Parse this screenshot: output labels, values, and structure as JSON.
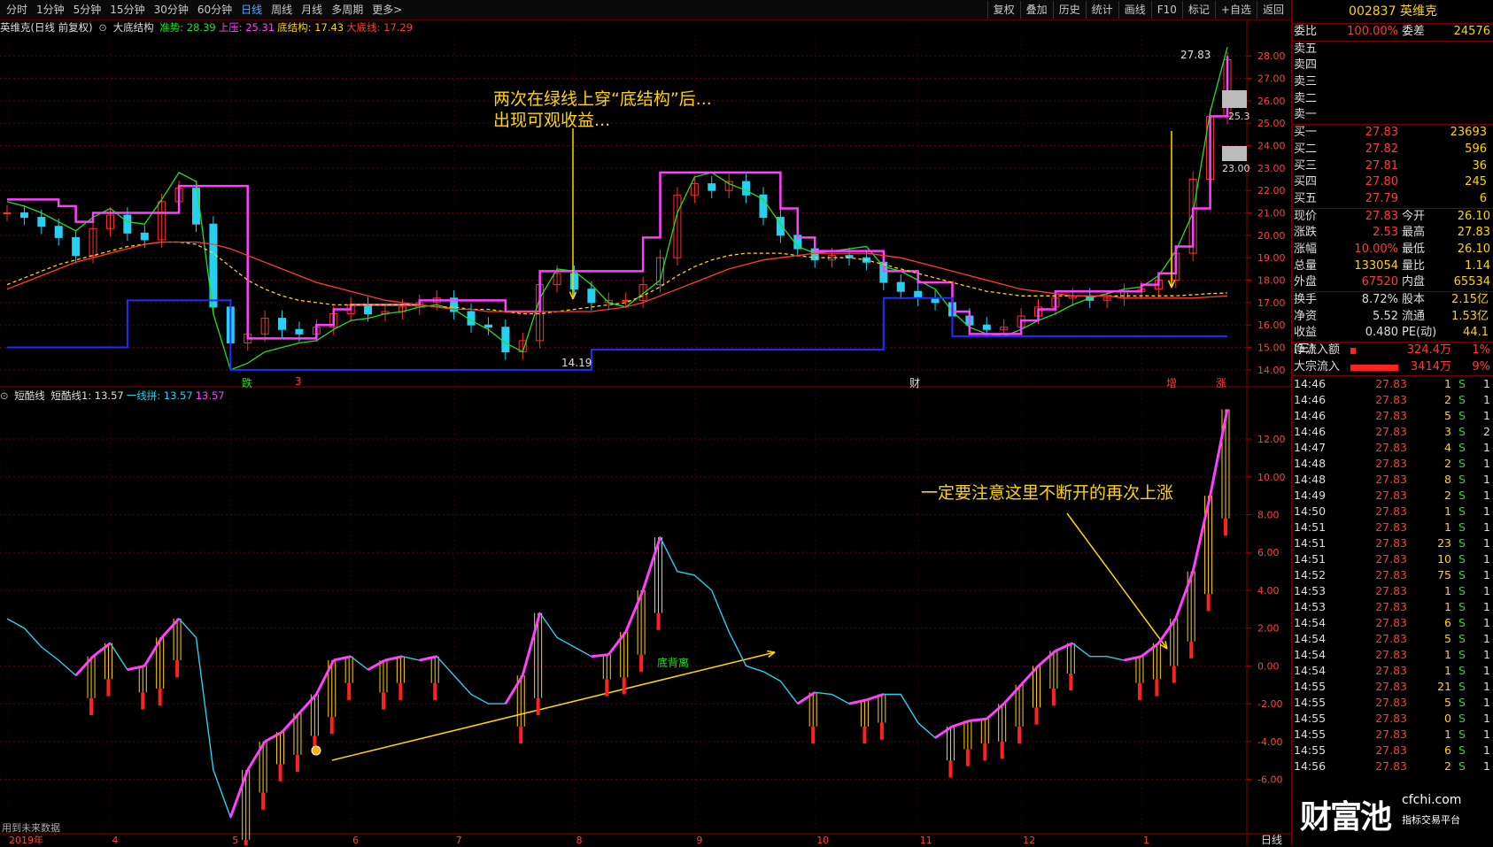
{
  "toolbar": {
    "periods": [
      "分时",
      "1分钟",
      "5分钟",
      "15分钟",
      "30分钟",
      "60分钟",
      "日线",
      "周线",
      "月线",
      "多周期",
      "更多>"
    ],
    "active_period": "日线",
    "right": [
      "复权",
      "叠加",
      "历史",
      "统计",
      "画线",
      "F10",
      "标记",
      "+自选",
      "返回"
    ]
  },
  "main_legend": {
    "stock": "英维克(日线 前复权)",
    "indicator": "大底结构",
    "items": [
      {
        "label": "准势: 28.39",
        "color": "#20e020"
      },
      {
        "label": "上压: 25.31",
        "color": "#ff40ff"
      },
      {
        "label": "底结构: 17.43",
        "color": "#ffd400"
      },
      {
        "label": "大底线: 17.29",
        "color": "#ff3b3b"
      }
    ]
  },
  "sub_legend": {
    "indicator": "短酷线",
    "items": [
      {
        "label": "短酷线1: 13.57",
        "color": "#dddddd"
      },
      {
        "label": "一线拼: 13.57",
        "color": "#25d0f0"
      },
      {
        "label": "13.57",
        "color": "#ff40ff"
      }
    ]
  },
  "annotations": {
    "top_line1": "两次在绿线上穿“底结构”后...",
    "top_line2": "出现可观收益...",
    "bottom": "一定要注意这里不断开的再次上涨",
    "divergence": "底背离",
    "low_label": "14.19",
    "high_label": "27.83",
    "gap_label1": "25.3",
    "gap_label2": "23.00",
    "future_data": "用到未来数据",
    "bottom_right": "日线"
  },
  "event_flags": [
    {
      "text": "跌",
      "color": "#20e020"
    },
    {
      "text": "3",
      "color": "#ff3b3b"
    },
    {
      "text": "财",
      "color": "#dddddd"
    },
    {
      "text": "增",
      "color": "#ff3b3b"
    },
    {
      "text": "涨",
      "color": "#ff3b3b"
    }
  ],
  "x_axis": [
    "2019年",
    "4",
    "5",
    "6",
    "7",
    "8",
    "9",
    "10",
    "11",
    "12",
    "1"
  ],
  "y_axis_main": [
    "28.00",
    "27.00",
    "26.00",
    "25.00",
    "24.00",
    "23.00",
    "22.00",
    "21.00",
    "20.00",
    "19.00",
    "18.00",
    "17.00",
    "16.00",
    "15.00",
    "14.00"
  ],
  "y_axis_sub": [
    "12.00",
    "10.00",
    "8.00",
    "6.00",
    "4.00",
    "2.00",
    "0.00",
    "-2.00",
    "-4.00",
    "-6.00"
  ],
  "quote": {
    "code_name": "002837 英维克",
    "weibi_label": "委比",
    "weibi": "100.00%",
    "weicha_label": "委差",
    "weicha": "24576",
    "asks": [
      {
        "label": "卖五",
        "price": "",
        "vol": ""
      },
      {
        "label": "卖四",
        "price": "",
        "vol": ""
      },
      {
        "label": "卖三",
        "price": "",
        "vol": ""
      },
      {
        "label": "卖二",
        "price": "",
        "vol": ""
      },
      {
        "label": "卖一",
        "price": "",
        "vol": ""
      }
    ],
    "bids": [
      {
        "label": "买一",
        "price": "27.83",
        "vol": "23693"
      },
      {
        "label": "买二",
        "price": "27.82",
        "vol": "596"
      },
      {
        "label": "买三",
        "price": "27.81",
        "vol": "36"
      },
      {
        "label": "买四",
        "price": "27.80",
        "vol": "245"
      },
      {
        "label": "买五",
        "price": "27.79",
        "vol": "6"
      }
    ],
    "stats": [
      {
        "l1": "现价",
        "v1": "27.83",
        "c1": "red",
        "l2": "今开",
        "v2": "26.10",
        "c2": "red"
      },
      {
        "l1": "涨跌",
        "v1": "2.53",
        "c1": "red",
        "l2": "最高",
        "v2": "27.83",
        "c2": "red"
      },
      {
        "l1": "涨幅",
        "v1": "10.00%",
        "c1": "red",
        "l2": "最低",
        "v2": "26.10",
        "c2": "red"
      },
      {
        "l1": "总量",
        "v1": "133054",
        "c1": "yellow",
        "l2": "量比",
        "v2": "1.14",
        "c2": "yellow"
      },
      {
        "l1": "外盘",
        "v1": "67520",
        "c1": "red",
        "l2": "内盘",
        "v2": "65534",
        "c2": "green"
      }
    ],
    "stats2": [
      {
        "l1": "换手",
        "v1": "8.72%",
        "l2": "股本",
        "v2": "2.15亿"
      },
      {
        "l1": "净资",
        "v1": "5.52",
        "l2": "流通",
        "v2": "1.53亿"
      },
      {
        "l1": "收益(三)",
        "v1": "0.480",
        "l2": "PE(动)",
        "v2": "44.1"
      }
    ],
    "flows": [
      {
        "label": "净流入额",
        "value": "324.4万",
        "pct": "1%",
        "bar": 0.02
      },
      {
        "label": "大宗流入",
        "value": "3414万",
        "pct": "9%",
        "bar": 0.18
      }
    ]
  },
  "ticks": [
    {
      "time": "14:46",
      "price": "27.83",
      "vol": "1",
      "bs": "S",
      "n": "1"
    },
    {
      "time": "14:46",
      "price": "27.83",
      "vol": "2",
      "bs": "S",
      "n": "1"
    },
    {
      "time": "14:46",
      "price": "27.83",
      "vol": "5",
      "bs": "S",
      "n": "1"
    },
    {
      "time": "14:46",
      "price": "27.83",
      "vol": "3",
      "bs": "S",
      "n": "2"
    },
    {
      "time": "14:47",
      "price": "27.83",
      "vol": "4",
      "bs": "S",
      "n": "1"
    },
    {
      "time": "14:48",
      "price": "27.83",
      "vol": "2",
      "bs": "S",
      "n": "1"
    },
    {
      "time": "14:48",
      "price": "27.83",
      "vol": "8",
      "bs": "S",
      "n": "1"
    },
    {
      "time": "14:49",
      "price": "27.83",
      "vol": "2",
      "bs": "S",
      "n": "1"
    },
    {
      "time": "14:50",
      "price": "27.83",
      "vol": "1",
      "bs": "S",
      "n": "1"
    },
    {
      "time": "14:51",
      "price": "27.83",
      "vol": "1",
      "bs": "S",
      "n": "1"
    },
    {
      "time": "14:51",
      "price": "27.83",
      "vol": "23",
      "bs": "S",
      "n": "1"
    },
    {
      "time": "14:51",
      "price": "27.83",
      "vol": "10",
      "bs": "S",
      "n": "1"
    },
    {
      "time": "14:52",
      "price": "27.83",
      "vol": "75",
      "bs": "S",
      "n": "1"
    },
    {
      "time": "14:53",
      "price": "27.83",
      "vol": "1",
      "bs": "S",
      "n": "1"
    },
    {
      "time": "14:53",
      "price": "27.83",
      "vol": "1",
      "bs": "S",
      "n": "1"
    },
    {
      "time": "14:54",
      "price": "27.83",
      "vol": "6",
      "bs": "S",
      "n": "1"
    },
    {
      "time": "14:54",
      "price": "27.83",
      "vol": "5",
      "bs": "S",
      "n": "1"
    },
    {
      "time": "14:54",
      "price": "27.83",
      "vol": "1",
      "bs": "S",
      "n": "1"
    },
    {
      "time": "14:54",
      "price": "27.83",
      "vol": "1",
      "bs": "S",
      "n": "1"
    },
    {
      "time": "14:55",
      "price": "27.83",
      "vol": "21",
      "bs": "S",
      "n": "1"
    },
    {
      "time": "14:55",
      "price": "27.83",
      "vol": "5",
      "bs": "S",
      "n": "1"
    },
    {
      "time": "14:55",
      "price": "27.83",
      "vol": "0",
      "bs": "S",
      "n": "1"
    },
    {
      "time": "14:55",
      "price": "27.83",
      "vol": "1",
      "bs": "S",
      "n": "1"
    },
    {
      "time": "14:55",
      "price": "27.83",
      "vol": "6",
      "bs": "S",
      "n": "1"
    },
    {
      "time": "14:56",
      "price": "27.83",
      "vol": "2",
      "bs": "S",
      "n": "1"
    }
  ],
  "watermark": {
    "main": "财富池",
    "site": "cfchi.com",
    "sub": "指标交易平台"
  },
  "chart_data": {
    "type": "line",
    "main_panel": {
      "ylim": [
        13.6,
        28.6
      ],
      "lows_marked": 14.19,
      "high_marked": 27.83,
      "series": [
        {
          "name": "准势",
          "color": "#20e020",
          "values": [
            21.5,
            21.3,
            21.0,
            20.6,
            20.2,
            20.8,
            21.2,
            20.6,
            20.5,
            21.6,
            22.8,
            22.4,
            16.5,
            14.0,
            14.3,
            14.8,
            15.0,
            15.2,
            15.3,
            15.8,
            16.2,
            16.3,
            16.5,
            16.6,
            16.8,
            16.9,
            16.7,
            16.2,
            15.8,
            15.2,
            14.8,
            17.2,
            18.5,
            18.4,
            17.8,
            17.0,
            16.8,
            17.4,
            18.0,
            21.0,
            22.6,
            22.8,
            22.3,
            22.0,
            21.6,
            20.5,
            19.5,
            19.2,
            19.3,
            19.4,
            19.5,
            18.6,
            18.4,
            18.0,
            17.6,
            16.6,
            15.9,
            15.6,
            15.5,
            15.8,
            16.2,
            16.5,
            16.9,
            17.2,
            17.4,
            17.6,
            17.7,
            18.2,
            19.3,
            21.0,
            25.5,
            28.39
          ]
        },
        {
          "name": "上压",
          "color": "#ff40ff",
          "values": [
            21.6,
            21.6,
            21.6,
            21.3,
            20.6,
            21.0,
            21.0,
            21.0,
            21.0,
            21.0,
            22.2,
            22.2,
            22.2,
            22.2,
            15.4,
            15.4,
            15.4,
            15.4,
            16.0,
            16.7,
            16.9,
            16.9,
            16.9,
            16.9,
            17.1,
            17.1,
            17.1,
            17.1,
            17.1,
            16.6,
            16.6,
            18.4,
            18.4,
            18.4,
            18.4,
            18.4,
            18.4,
            19.9,
            22.8,
            22.8,
            22.8,
            22.8,
            22.8,
            22.8,
            22.8,
            21.2,
            19.9,
            19.3,
            19.3,
            19.3,
            19.3,
            18.4,
            18.4,
            17.9,
            17.9,
            16.6,
            15.6,
            15.6,
            15.6,
            16.2,
            16.7,
            17.5,
            17.5,
            17.5,
            17.5,
            17.5,
            17.8,
            18.3,
            19.5,
            21.2,
            25.31,
            28.0
          ]
        },
        {
          "name": "底结构",
          "color": "#ffd400",
          "values": [
            17.8,
            18.1,
            18.4,
            18.7,
            18.9,
            19.1,
            19.3,
            19.5,
            19.6,
            19.7,
            19.7,
            19.6,
            19.2,
            18.6,
            18.0,
            17.6,
            17.3,
            17.1,
            17.0,
            16.9,
            16.9,
            16.9,
            16.9,
            16.9,
            16.9,
            16.8,
            16.8,
            16.7,
            16.7,
            16.6,
            16.5,
            16.5,
            16.6,
            16.7,
            16.8,
            16.9,
            17.0,
            17.3,
            17.7,
            18.2,
            18.6,
            18.9,
            19.1,
            19.2,
            19.2,
            19.2,
            19.1,
            19.0,
            19.0,
            19.0,
            18.9,
            18.7,
            18.5,
            18.3,
            18.1,
            17.9,
            17.7,
            17.5,
            17.4,
            17.3,
            17.3,
            17.3,
            17.3,
            17.3,
            17.3,
            17.3,
            17.3,
            17.3,
            17.3,
            17.35,
            17.4,
            17.43
          ]
        },
        {
          "name": "大底线",
          "color": "#ff3b3b",
          "values": [
            17.6,
            17.9,
            18.2,
            18.5,
            18.8,
            19.0,
            19.2,
            19.4,
            19.6,
            19.7,
            19.7,
            19.7,
            19.6,
            19.4,
            19.1,
            18.8,
            18.5,
            18.2,
            17.9,
            17.7,
            17.5,
            17.3,
            17.1,
            17.0,
            16.9,
            16.8,
            16.7,
            16.7,
            16.6,
            16.6,
            16.6,
            16.6,
            16.6,
            16.6,
            16.6,
            16.7,
            16.8,
            17.0,
            17.3,
            17.6,
            17.9,
            18.2,
            18.5,
            18.7,
            18.9,
            19.0,
            19.1,
            19.2,
            19.2,
            19.2,
            19.2,
            19.1,
            19.0,
            18.8,
            18.6,
            18.4,
            18.2,
            18.0,
            17.8,
            17.6,
            17.5,
            17.4,
            17.3,
            17.3,
            17.3,
            17.2,
            17.2,
            17.2,
            17.2,
            17.2,
            17.25,
            17.29
          ]
        },
        {
          "name": "底部支撑",
          "color": "#1f2fff",
          "values": [
            15.0,
            15.0,
            15.0,
            15.0,
            15.0,
            15.0,
            15.0,
            17.1,
            17.1,
            17.1,
            17.1,
            17.1,
            17.1,
            14.0,
            14.0,
            14.0,
            14.0,
            14.0,
            14.0,
            14.0,
            14.0,
            14.0,
            14.0,
            14.0,
            14.0,
            14.0,
            14.0,
            14.0,
            14.0,
            14.0,
            14.0,
            14.0,
            14.0,
            14.0,
            14.9,
            14.9,
            14.9,
            14.9,
            14.9,
            14.9,
            14.9,
            14.9,
            14.9,
            14.9,
            14.9,
            14.9,
            14.9,
            14.9,
            14.9,
            14.9,
            14.9,
            17.2,
            17.2,
            17.2,
            17.2,
            15.5,
            15.5,
            15.5,
            15.5,
            15.5,
            15.5,
            15.5,
            15.5,
            15.5,
            15.5,
            15.5,
            15.5,
            15.5,
            15.5,
            15.5,
            15.5,
            15.5
          ]
        }
      ],
      "candles_close": [
        21.0,
        20.8,
        20.4,
        19.9,
        19.1,
        20.3,
        20.9,
        20.1,
        19.8,
        21.5,
        22.1,
        20.5,
        16.8,
        15.2,
        15.6,
        16.3,
        15.8,
        15.6,
        15.9,
        16.5,
        16.9,
        16.5,
        16.6,
        16.8,
        17.0,
        17.2,
        16.6,
        16.0,
        15.9,
        14.8,
        15.3,
        17.8,
        18.3,
        17.6,
        17.0,
        17.1,
        17.1,
        17.8,
        19.0,
        21.8,
        22.3,
        22.0,
        22.4,
        21.8,
        20.8,
        20.0,
        19.4,
        18.9,
        19.1,
        19.0,
        18.8,
        17.9,
        17.5,
        17.2,
        17.0,
        16.4,
        16.0,
        15.8,
        15.9,
        16.4,
        16.8,
        17.2,
        17.3,
        17.1,
        17.2,
        17.5,
        17.6,
        18.0,
        19.2,
        22.5,
        25.3,
        27.83
      ]
    },
    "sub_panel": {
      "ylim": [
        -8.5,
        13.5
      ],
      "series": [
        {
          "name": "短酷线",
          "color": "#25d0f0",
          "values": [
            2.5,
            2.0,
            1.0,
            0.3,
            -0.5,
            0.5,
            1.2,
            -0.2,
            0.0,
            1.5,
            2.5,
            1.5,
            -5.5,
            -8.0,
            -5.5,
            -4.0,
            -3.5,
            -2.5,
            -1.5,
            0.3,
            0.5,
            -0.2,
            0.3,
            0.5,
            0.3,
            0.5,
            -0.5,
            -1.5,
            -2.0,
            -2.0,
            -0.5,
            2.8,
            1.5,
            1.0,
            0.5,
            0.6,
            1.8,
            4.0,
            6.8,
            5.0,
            4.8,
            4.0,
            1.8,
            0.0,
            -0.3,
            -0.8,
            -2.0,
            -1.4,
            -1.5,
            -2.0,
            -1.8,
            -1.5,
            -1.5,
            -3.0,
            -3.8,
            -3.2,
            -2.9,
            -2.8,
            -2.0,
            -1.0,
            0.0,
            0.8,
            1.2,
            0.5,
            0.5,
            0.3,
            0.5,
            1.2,
            2.5,
            5.0,
            9.0,
            13.57
          ]
        }
      ]
    }
  }
}
